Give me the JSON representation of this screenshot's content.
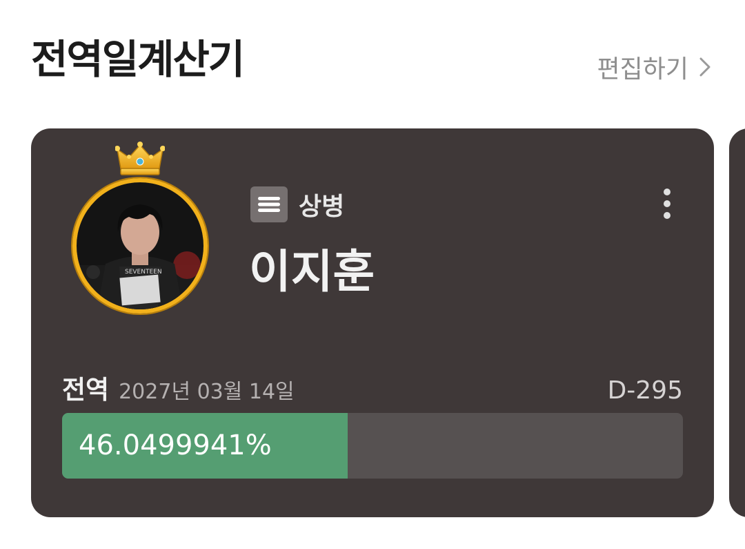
{
  "header": {
    "title": "전역일계산기",
    "edit_label": "편집하기"
  },
  "card": {
    "rank": "상병",
    "name": "이지훈",
    "discharge_label": "전역",
    "discharge_date": "2027년 03월 14일",
    "dday": "D-295",
    "progress_text": "46.0499941%",
    "progress_fraction": 0.460499941,
    "avatar_badge_text": "SEVENTEEN"
  },
  "icons": {
    "chevron": "chevron-right-icon",
    "crown": "crown-icon",
    "rank": "menu-lines-icon",
    "more": "more-vertical-icon"
  },
  "colors": {
    "card_bg": "#3f3838",
    "progress_fill": "#559e72",
    "progress_track": "#565151",
    "ring": "#f2b11b"
  }
}
